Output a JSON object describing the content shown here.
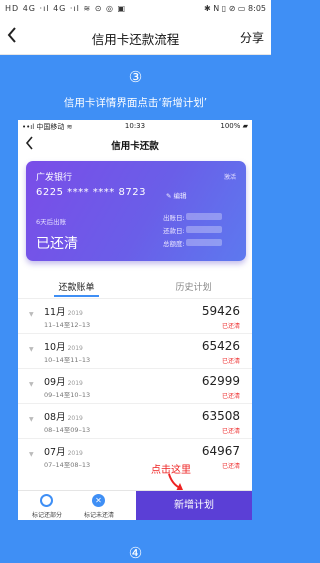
{
  "status_bar": {
    "left": "HD 4G ·ıl 4G ·ıl ≋ ⊙ ◎ ▣",
    "right": "✱ N ▯ ⊘ ▭ 8:05"
  },
  "nav": {
    "back_icon": "chevron-left-icon",
    "title": "信用卡还款流程",
    "share_label": "分享"
  },
  "step3": "③",
  "caption": "信用卡详情界面点击‘新增计划’",
  "phone": {
    "status_bar": {
      "carrier": "••ıl 中国移动 ≋",
      "time": "10:33",
      "battery": "100% ▰"
    },
    "nav": {
      "back_icon": "chevron-left-icon",
      "title": "信用卡还款"
    },
    "card": {
      "bank": "广发银行",
      "badge": "激活",
      "number": "6225 **** **** 8723",
      "edit_label": "✎ 编辑",
      "due_text": "6天后出账",
      "status": "已还清",
      "details": [
        {
          "label": "出账日:"
        },
        {
          "label": "还款日:"
        },
        {
          "label": "总额度:"
        }
      ]
    },
    "tabs": [
      {
        "label": "还款账单"
      },
      {
        "label": "历史计划"
      }
    ],
    "bills": [
      {
        "month": "11月",
        "year": "2019",
        "range": "11–14至12–13",
        "amount": "59426",
        "status": "已还清"
      },
      {
        "month": "10月",
        "year": "2019",
        "range": "10–14至11–13",
        "amount": "65426",
        "status": "已还清"
      },
      {
        "month": "09月",
        "year": "2019",
        "range": "09–14至10–13",
        "amount": "62999",
        "status": "已还清"
      },
      {
        "month": "08月",
        "year": "2019",
        "range": "08–14至09–13",
        "amount": "63508",
        "status": "已还清"
      },
      {
        "month": "07月",
        "year": "2019",
        "range": "07–14至08–13",
        "amount": "64967",
        "status": "已还清"
      }
    ],
    "bottom": {
      "mark_partial": "标记还部分",
      "mark_unpaid": "标记未还清",
      "add_plan": "新增计划"
    },
    "hint": "点击这里"
  },
  "step4": "④",
  "colors": {
    "background": "#3f8ff5",
    "card_gradient_start": "#7a4de8",
    "add_button": "#5b3fd6",
    "paid_red": "#e33"
  }
}
